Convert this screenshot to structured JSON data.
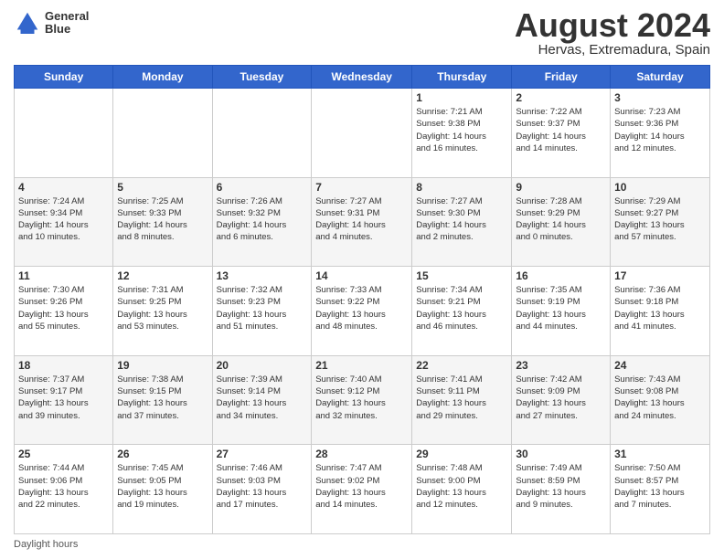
{
  "logo": {
    "line1": "General",
    "line2": "Blue"
  },
  "title": "August 2024",
  "subtitle": "Hervas, Extremadura, Spain",
  "days_of_week": [
    "Sunday",
    "Monday",
    "Tuesday",
    "Wednesday",
    "Thursday",
    "Friday",
    "Saturday"
  ],
  "footer_label": "Daylight hours",
  "weeks": [
    [
      {
        "num": "",
        "detail": ""
      },
      {
        "num": "",
        "detail": ""
      },
      {
        "num": "",
        "detail": ""
      },
      {
        "num": "",
        "detail": ""
      },
      {
        "num": "1",
        "detail": "Sunrise: 7:21 AM\nSunset: 9:38 PM\nDaylight: 14 hours\nand 16 minutes."
      },
      {
        "num": "2",
        "detail": "Sunrise: 7:22 AM\nSunset: 9:37 PM\nDaylight: 14 hours\nand 14 minutes."
      },
      {
        "num": "3",
        "detail": "Sunrise: 7:23 AM\nSunset: 9:36 PM\nDaylight: 14 hours\nand 12 minutes."
      }
    ],
    [
      {
        "num": "4",
        "detail": "Sunrise: 7:24 AM\nSunset: 9:34 PM\nDaylight: 14 hours\nand 10 minutes."
      },
      {
        "num": "5",
        "detail": "Sunrise: 7:25 AM\nSunset: 9:33 PM\nDaylight: 14 hours\nand 8 minutes."
      },
      {
        "num": "6",
        "detail": "Sunrise: 7:26 AM\nSunset: 9:32 PM\nDaylight: 14 hours\nand 6 minutes."
      },
      {
        "num": "7",
        "detail": "Sunrise: 7:27 AM\nSunset: 9:31 PM\nDaylight: 14 hours\nand 4 minutes."
      },
      {
        "num": "8",
        "detail": "Sunrise: 7:27 AM\nSunset: 9:30 PM\nDaylight: 14 hours\nand 2 minutes."
      },
      {
        "num": "9",
        "detail": "Sunrise: 7:28 AM\nSunset: 9:29 PM\nDaylight: 14 hours\nand 0 minutes."
      },
      {
        "num": "10",
        "detail": "Sunrise: 7:29 AM\nSunset: 9:27 PM\nDaylight: 13 hours\nand 57 minutes."
      }
    ],
    [
      {
        "num": "11",
        "detail": "Sunrise: 7:30 AM\nSunset: 9:26 PM\nDaylight: 13 hours\nand 55 minutes."
      },
      {
        "num": "12",
        "detail": "Sunrise: 7:31 AM\nSunset: 9:25 PM\nDaylight: 13 hours\nand 53 minutes."
      },
      {
        "num": "13",
        "detail": "Sunrise: 7:32 AM\nSunset: 9:23 PM\nDaylight: 13 hours\nand 51 minutes."
      },
      {
        "num": "14",
        "detail": "Sunrise: 7:33 AM\nSunset: 9:22 PM\nDaylight: 13 hours\nand 48 minutes."
      },
      {
        "num": "15",
        "detail": "Sunrise: 7:34 AM\nSunset: 9:21 PM\nDaylight: 13 hours\nand 46 minutes."
      },
      {
        "num": "16",
        "detail": "Sunrise: 7:35 AM\nSunset: 9:19 PM\nDaylight: 13 hours\nand 44 minutes."
      },
      {
        "num": "17",
        "detail": "Sunrise: 7:36 AM\nSunset: 9:18 PM\nDaylight: 13 hours\nand 41 minutes."
      }
    ],
    [
      {
        "num": "18",
        "detail": "Sunrise: 7:37 AM\nSunset: 9:17 PM\nDaylight: 13 hours\nand 39 minutes."
      },
      {
        "num": "19",
        "detail": "Sunrise: 7:38 AM\nSunset: 9:15 PM\nDaylight: 13 hours\nand 37 minutes."
      },
      {
        "num": "20",
        "detail": "Sunrise: 7:39 AM\nSunset: 9:14 PM\nDaylight: 13 hours\nand 34 minutes."
      },
      {
        "num": "21",
        "detail": "Sunrise: 7:40 AM\nSunset: 9:12 PM\nDaylight: 13 hours\nand 32 minutes."
      },
      {
        "num": "22",
        "detail": "Sunrise: 7:41 AM\nSunset: 9:11 PM\nDaylight: 13 hours\nand 29 minutes."
      },
      {
        "num": "23",
        "detail": "Sunrise: 7:42 AM\nSunset: 9:09 PM\nDaylight: 13 hours\nand 27 minutes."
      },
      {
        "num": "24",
        "detail": "Sunrise: 7:43 AM\nSunset: 9:08 PM\nDaylight: 13 hours\nand 24 minutes."
      }
    ],
    [
      {
        "num": "25",
        "detail": "Sunrise: 7:44 AM\nSunset: 9:06 PM\nDaylight: 13 hours\nand 22 minutes."
      },
      {
        "num": "26",
        "detail": "Sunrise: 7:45 AM\nSunset: 9:05 PM\nDaylight: 13 hours\nand 19 minutes."
      },
      {
        "num": "27",
        "detail": "Sunrise: 7:46 AM\nSunset: 9:03 PM\nDaylight: 13 hours\nand 17 minutes."
      },
      {
        "num": "28",
        "detail": "Sunrise: 7:47 AM\nSunset: 9:02 PM\nDaylight: 13 hours\nand 14 minutes."
      },
      {
        "num": "29",
        "detail": "Sunrise: 7:48 AM\nSunset: 9:00 PM\nDaylight: 13 hours\nand 12 minutes."
      },
      {
        "num": "30",
        "detail": "Sunrise: 7:49 AM\nSunset: 8:59 PM\nDaylight: 13 hours\nand 9 minutes."
      },
      {
        "num": "31",
        "detail": "Sunrise: 7:50 AM\nSunset: 8:57 PM\nDaylight: 13 hours\nand 7 minutes."
      }
    ]
  ]
}
